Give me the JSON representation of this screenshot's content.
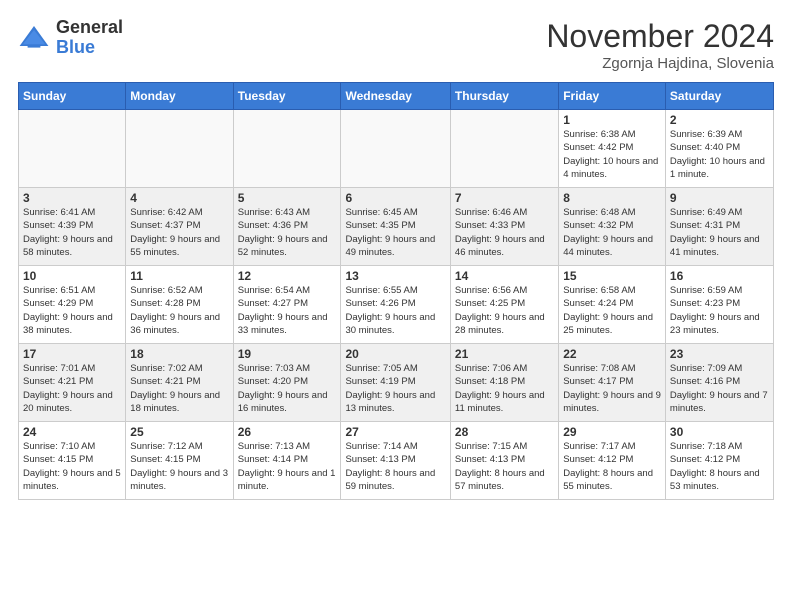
{
  "logo": {
    "general": "General",
    "blue": "Blue"
  },
  "title": "November 2024",
  "location": "Zgornja Hajdina, Slovenia",
  "days_of_week": [
    "Sunday",
    "Monday",
    "Tuesday",
    "Wednesday",
    "Thursday",
    "Friday",
    "Saturday"
  ],
  "weeks": [
    [
      {
        "day": "",
        "info": "",
        "empty": true
      },
      {
        "day": "",
        "info": "",
        "empty": true
      },
      {
        "day": "",
        "info": "",
        "empty": true
      },
      {
        "day": "",
        "info": "",
        "empty": true
      },
      {
        "day": "",
        "info": "",
        "empty": true
      },
      {
        "day": "1",
        "info": "Sunrise: 6:38 AM\nSunset: 4:42 PM\nDaylight: 10 hours\nand 4 minutes."
      },
      {
        "day": "2",
        "info": "Sunrise: 6:39 AM\nSunset: 4:40 PM\nDaylight: 10 hours\nand 1 minute."
      }
    ],
    [
      {
        "day": "3",
        "info": "Sunrise: 6:41 AM\nSunset: 4:39 PM\nDaylight: 9 hours\nand 58 minutes."
      },
      {
        "day": "4",
        "info": "Sunrise: 6:42 AM\nSunset: 4:37 PM\nDaylight: 9 hours\nand 55 minutes."
      },
      {
        "day": "5",
        "info": "Sunrise: 6:43 AM\nSunset: 4:36 PM\nDaylight: 9 hours\nand 52 minutes."
      },
      {
        "day": "6",
        "info": "Sunrise: 6:45 AM\nSunset: 4:35 PM\nDaylight: 9 hours\nand 49 minutes."
      },
      {
        "day": "7",
        "info": "Sunrise: 6:46 AM\nSunset: 4:33 PM\nDaylight: 9 hours\nand 46 minutes."
      },
      {
        "day": "8",
        "info": "Sunrise: 6:48 AM\nSunset: 4:32 PM\nDaylight: 9 hours\nand 44 minutes."
      },
      {
        "day": "9",
        "info": "Sunrise: 6:49 AM\nSunset: 4:31 PM\nDaylight: 9 hours\nand 41 minutes."
      }
    ],
    [
      {
        "day": "10",
        "info": "Sunrise: 6:51 AM\nSunset: 4:29 PM\nDaylight: 9 hours\nand 38 minutes."
      },
      {
        "day": "11",
        "info": "Sunrise: 6:52 AM\nSunset: 4:28 PM\nDaylight: 9 hours\nand 36 minutes."
      },
      {
        "day": "12",
        "info": "Sunrise: 6:54 AM\nSunset: 4:27 PM\nDaylight: 9 hours\nand 33 minutes."
      },
      {
        "day": "13",
        "info": "Sunrise: 6:55 AM\nSunset: 4:26 PM\nDaylight: 9 hours\nand 30 minutes."
      },
      {
        "day": "14",
        "info": "Sunrise: 6:56 AM\nSunset: 4:25 PM\nDaylight: 9 hours\nand 28 minutes."
      },
      {
        "day": "15",
        "info": "Sunrise: 6:58 AM\nSunset: 4:24 PM\nDaylight: 9 hours\nand 25 minutes."
      },
      {
        "day": "16",
        "info": "Sunrise: 6:59 AM\nSunset: 4:23 PM\nDaylight: 9 hours\nand 23 minutes."
      }
    ],
    [
      {
        "day": "17",
        "info": "Sunrise: 7:01 AM\nSunset: 4:21 PM\nDaylight: 9 hours\nand 20 minutes."
      },
      {
        "day": "18",
        "info": "Sunrise: 7:02 AM\nSunset: 4:21 PM\nDaylight: 9 hours\nand 18 minutes."
      },
      {
        "day": "19",
        "info": "Sunrise: 7:03 AM\nSunset: 4:20 PM\nDaylight: 9 hours\nand 16 minutes."
      },
      {
        "day": "20",
        "info": "Sunrise: 7:05 AM\nSunset: 4:19 PM\nDaylight: 9 hours\nand 13 minutes."
      },
      {
        "day": "21",
        "info": "Sunrise: 7:06 AM\nSunset: 4:18 PM\nDaylight: 9 hours\nand 11 minutes."
      },
      {
        "day": "22",
        "info": "Sunrise: 7:08 AM\nSunset: 4:17 PM\nDaylight: 9 hours\nand 9 minutes."
      },
      {
        "day": "23",
        "info": "Sunrise: 7:09 AM\nSunset: 4:16 PM\nDaylight: 9 hours\nand 7 minutes."
      }
    ],
    [
      {
        "day": "24",
        "info": "Sunrise: 7:10 AM\nSunset: 4:15 PM\nDaylight: 9 hours\nand 5 minutes."
      },
      {
        "day": "25",
        "info": "Sunrise: 7:12 AM\nSunset: 4:15 PM\nDaylight: 9 hours\nand 3 minutes."
      },
      {
        "day": "26",
        "info": "Sunrise: 7:13 AM\nSunset: 4:14 PM\nDaylight: 9 hours\nand 1 minute."
      },
      {
        "day": "27",
        "info": "Sunrise: 7:14 AM\nSunset: 4:13 PM\nDaylight: 8 hours\nand 59 minutes."
      },
      {
        "day": "28",
        "info": "Sunrise: 7:15 AM\nSunset: 4:13 PM\nDaylight: 8 hours\nand 57 minutes."
      },
      {
        "day": "29",
        "info": "Sunrise: 7:17 AM\nSunset: 4:12 PM\nDaylight: 8 hours\nand 55 minutes."
      },
      {
        "day": "30",
        "info": "Sunrise: 7:18 AM\nSunset: 4:12 PM\nDaylight: 8 hours\nand 53 minutes."
      }
    ]
  ]
}
